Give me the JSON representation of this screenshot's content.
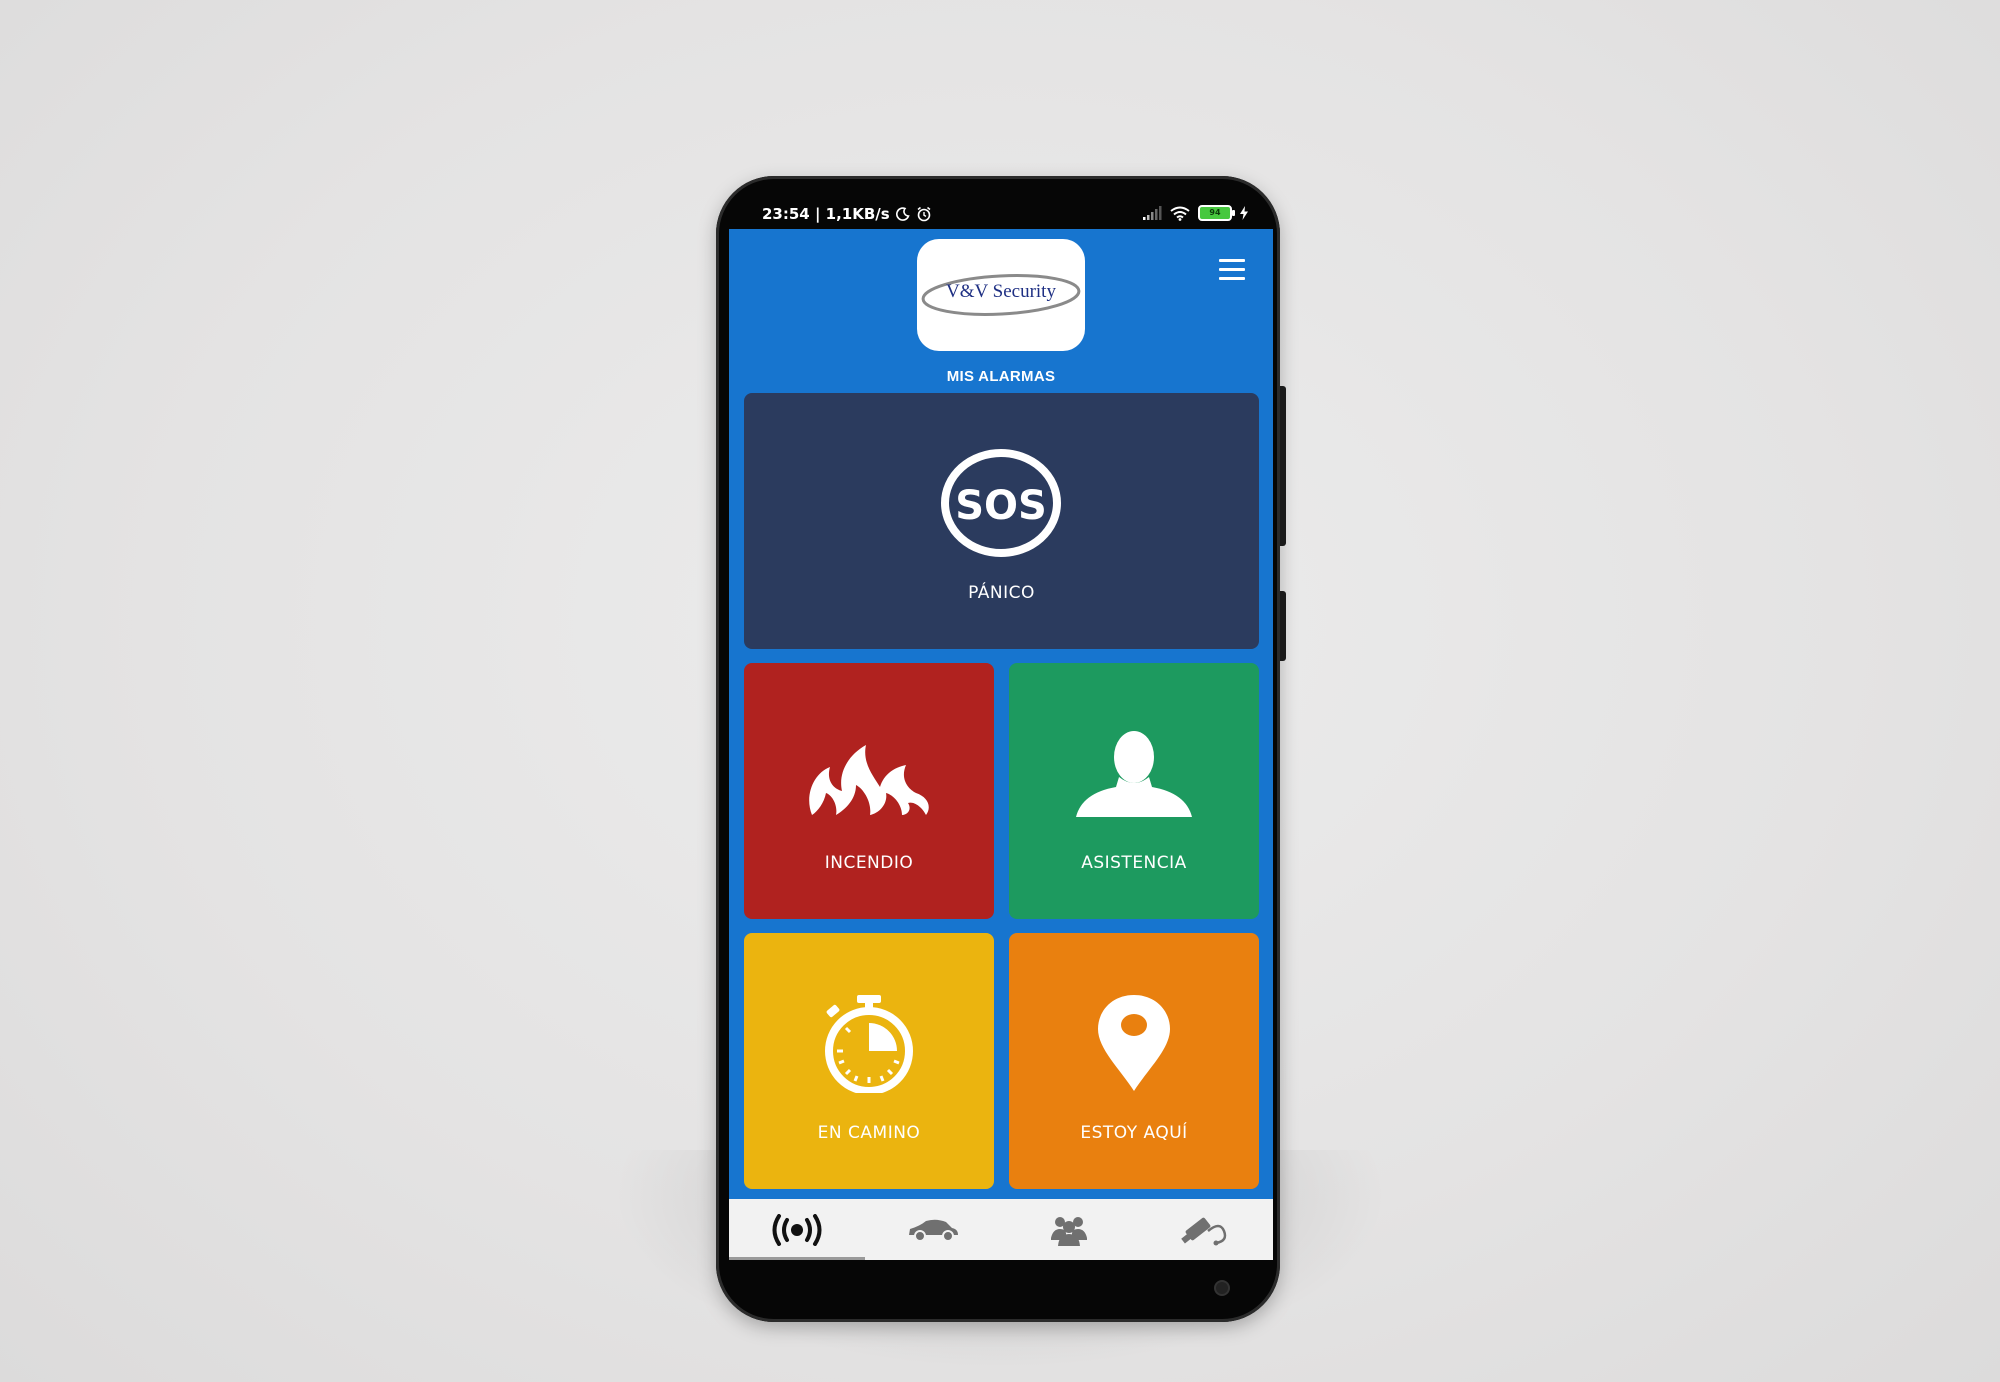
{
  "status_bar": {
    "time_net": "23:54 | 1,1KB/s",
    "battery": "94"
  },
  "header": {
    "logo_text": "V&V Security",
    "section_title": "MIS ALARMAS"
  },
  "tiles": [
    {
      "label": "PÁNICO",
      "icon_text": "SOS",
      "color": "#2b3b5e",
      "icon": "sos-icon"
    },
    {
      "label": "INCENDIO",
      "color": "#b0221f",
      "icon": "fire-icon"
    },
    {
      "label": "ASISTENCIA",
      "color": "#1d9a5f",
      "icon": "person-icon"
    },
    {
      "label": "EN CAMINO",
      "color": "#ebb40f",
      "icon": "stopwatch-icon"
    },
    {
      "label": "ESTOY AQUÍ",
      "color": "#e9800f",
      "icon": "location-pin-icon"
    }
  ],
  "bottom_nav": {
    "items": [
      "alarm-broadcast-icon",
      "car-icon",
      "group-icon",
      "camera-icon"
    ],
    "active_index": 0
  },
  "colors": {
    "screen_background": "#1775cf",
    "nav_background": "#f2f2f2",
    "nav_icon": "#707070",
    "nav_icon_active": "#111111"
  }
}
